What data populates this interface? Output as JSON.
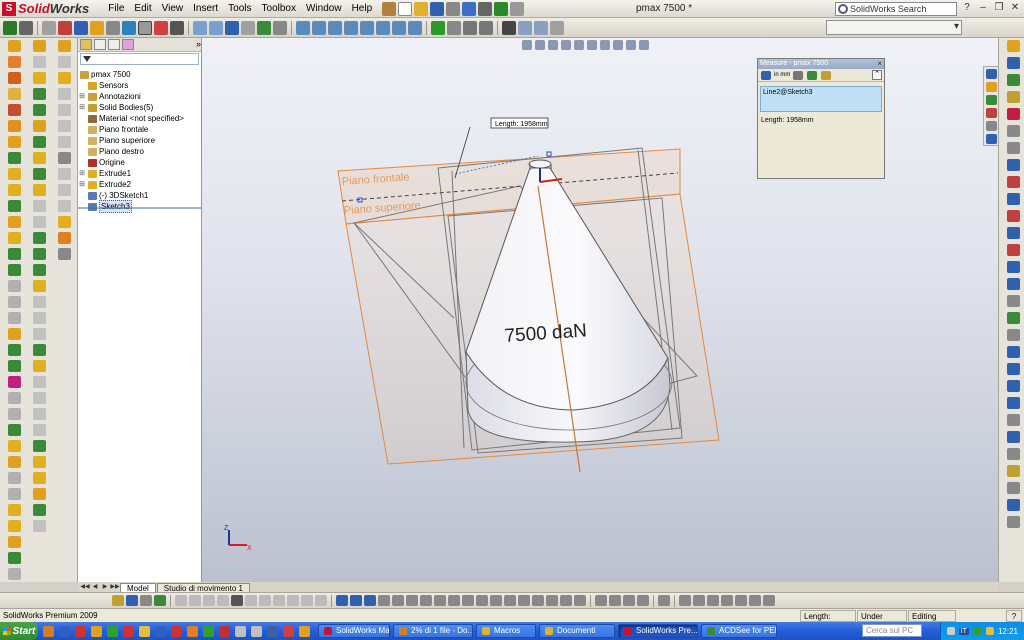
{
  "app": {
    "brand_prefix": "Solid",
    "brand_suffix": "Works",
    "document_title": "pmax 7500 *"
  },
  "menu": [
    "File",
    "Edit",
    "View",
    "Insert",
    "Tools",
    "Toolbox",
    "Window",
    "Help"
  ],
  "search": {
    "placeholder": "SolidWorks Search"
  },
  "feature_tree": {
    "root": "pmax 7500",
    "items": [
      {
        "label": "Sensors",
        "expandable": false,
        "icon_color": "#d9a520"
      },
      {
        "label": "Annotazioni",
        "expandable": true,
        "icon_color": "#c8a040"
      },
      {
        "label": "Solid Bodies(5)",
        "expandable": true,
        "icon_color": "#c0a030"
      },
      {
        "label": "Material <not specified>",
        "expandable": false,
        "icon_color": "#8c6a3a"
      },
      {
        "label": "Piano frontale",
        "expandable": false,
        "icon_color": "#d6b060"
      },
      {
        "label": "Piano superiore",
        "expandable": false,
        "icon_color": "#d6b060"
      },
      {
        "label": "Piano destro",
        "expandable": false,
        "icon_color": "#d6b060"
      },
      {
        "label": "Origine",
        "expandable": false,
        "icon_color": "#b03030"
      },
      {
        "label": "Extrude1",
        "expandable": true,
        "icon_color": "#e0b020"
      },
      {
        "label": "Extrude2",
        "expandable": true,
        "icon_color": "#e0b020"
      },
      {
        "label": "(-) 3DSketch1",
        "expandable": false,
        "icon_color": "#5a7ab0"
      },
      {
        "label": "Sketch3",
        "expandable": false,
        "icon_color": "#5a7ab0",
        "selected": true
      }
    ]
  },
  "viewport": {
    "length_callout": "Length: 1958mm",
    "plane_front_label": "Piano frontale",
    "plane_top_label": "Piano superiore",
    "cone_text": "7500 daN",
    "triad_z": "Z",
    "triad_x": "X"
  },
  "measure_dialog": {
    "title": "Measure - pmax 7500",
    "units_label": "in mm",
    "selection": "Line2@Sketch3",
    "result": "Length: 1958mm",
    "collapse_symbol": "⌃",
    "close_symbol": "×"
  },
  "model_tabs": [
    "Model",
    "Studio di movimento 1"
  ],
  "status_bar": {
    "left": "SolidWorks Premium 2009",
    "length": "Length: 1958mm",
    "state": "Under Defined",
    "mode": "Editing Part",
    "help": "?"
  },
  "taskbar": {
    "start": "Start",
    "items": [
      {
        "label": "SolidWorks Macro...",
        "active": false
      },
      {
        "label": "2% di 1 file - Do...",
        "active": false
      },
      {
        "label": "Macros",
        "active": false
      },
      {
        "label": "Documenti",
        "active": false
      },
      {
        "label": "SolidWorks Pre...",
        "active": true
      },
      {
        "label": "ACDSee for PENT...",
        "active": false
      }
    ],
    "search_placeholder": "Cerca sul PC",
    "tray_lang": "IT",
    "clock": "12:21"
  },
  "colors": {
    "accent": "#c8102e",
    "plane": "#e0924a",
    "selection": "#bfe0f5",
    "taskbar": "#245edb"
  }
}
